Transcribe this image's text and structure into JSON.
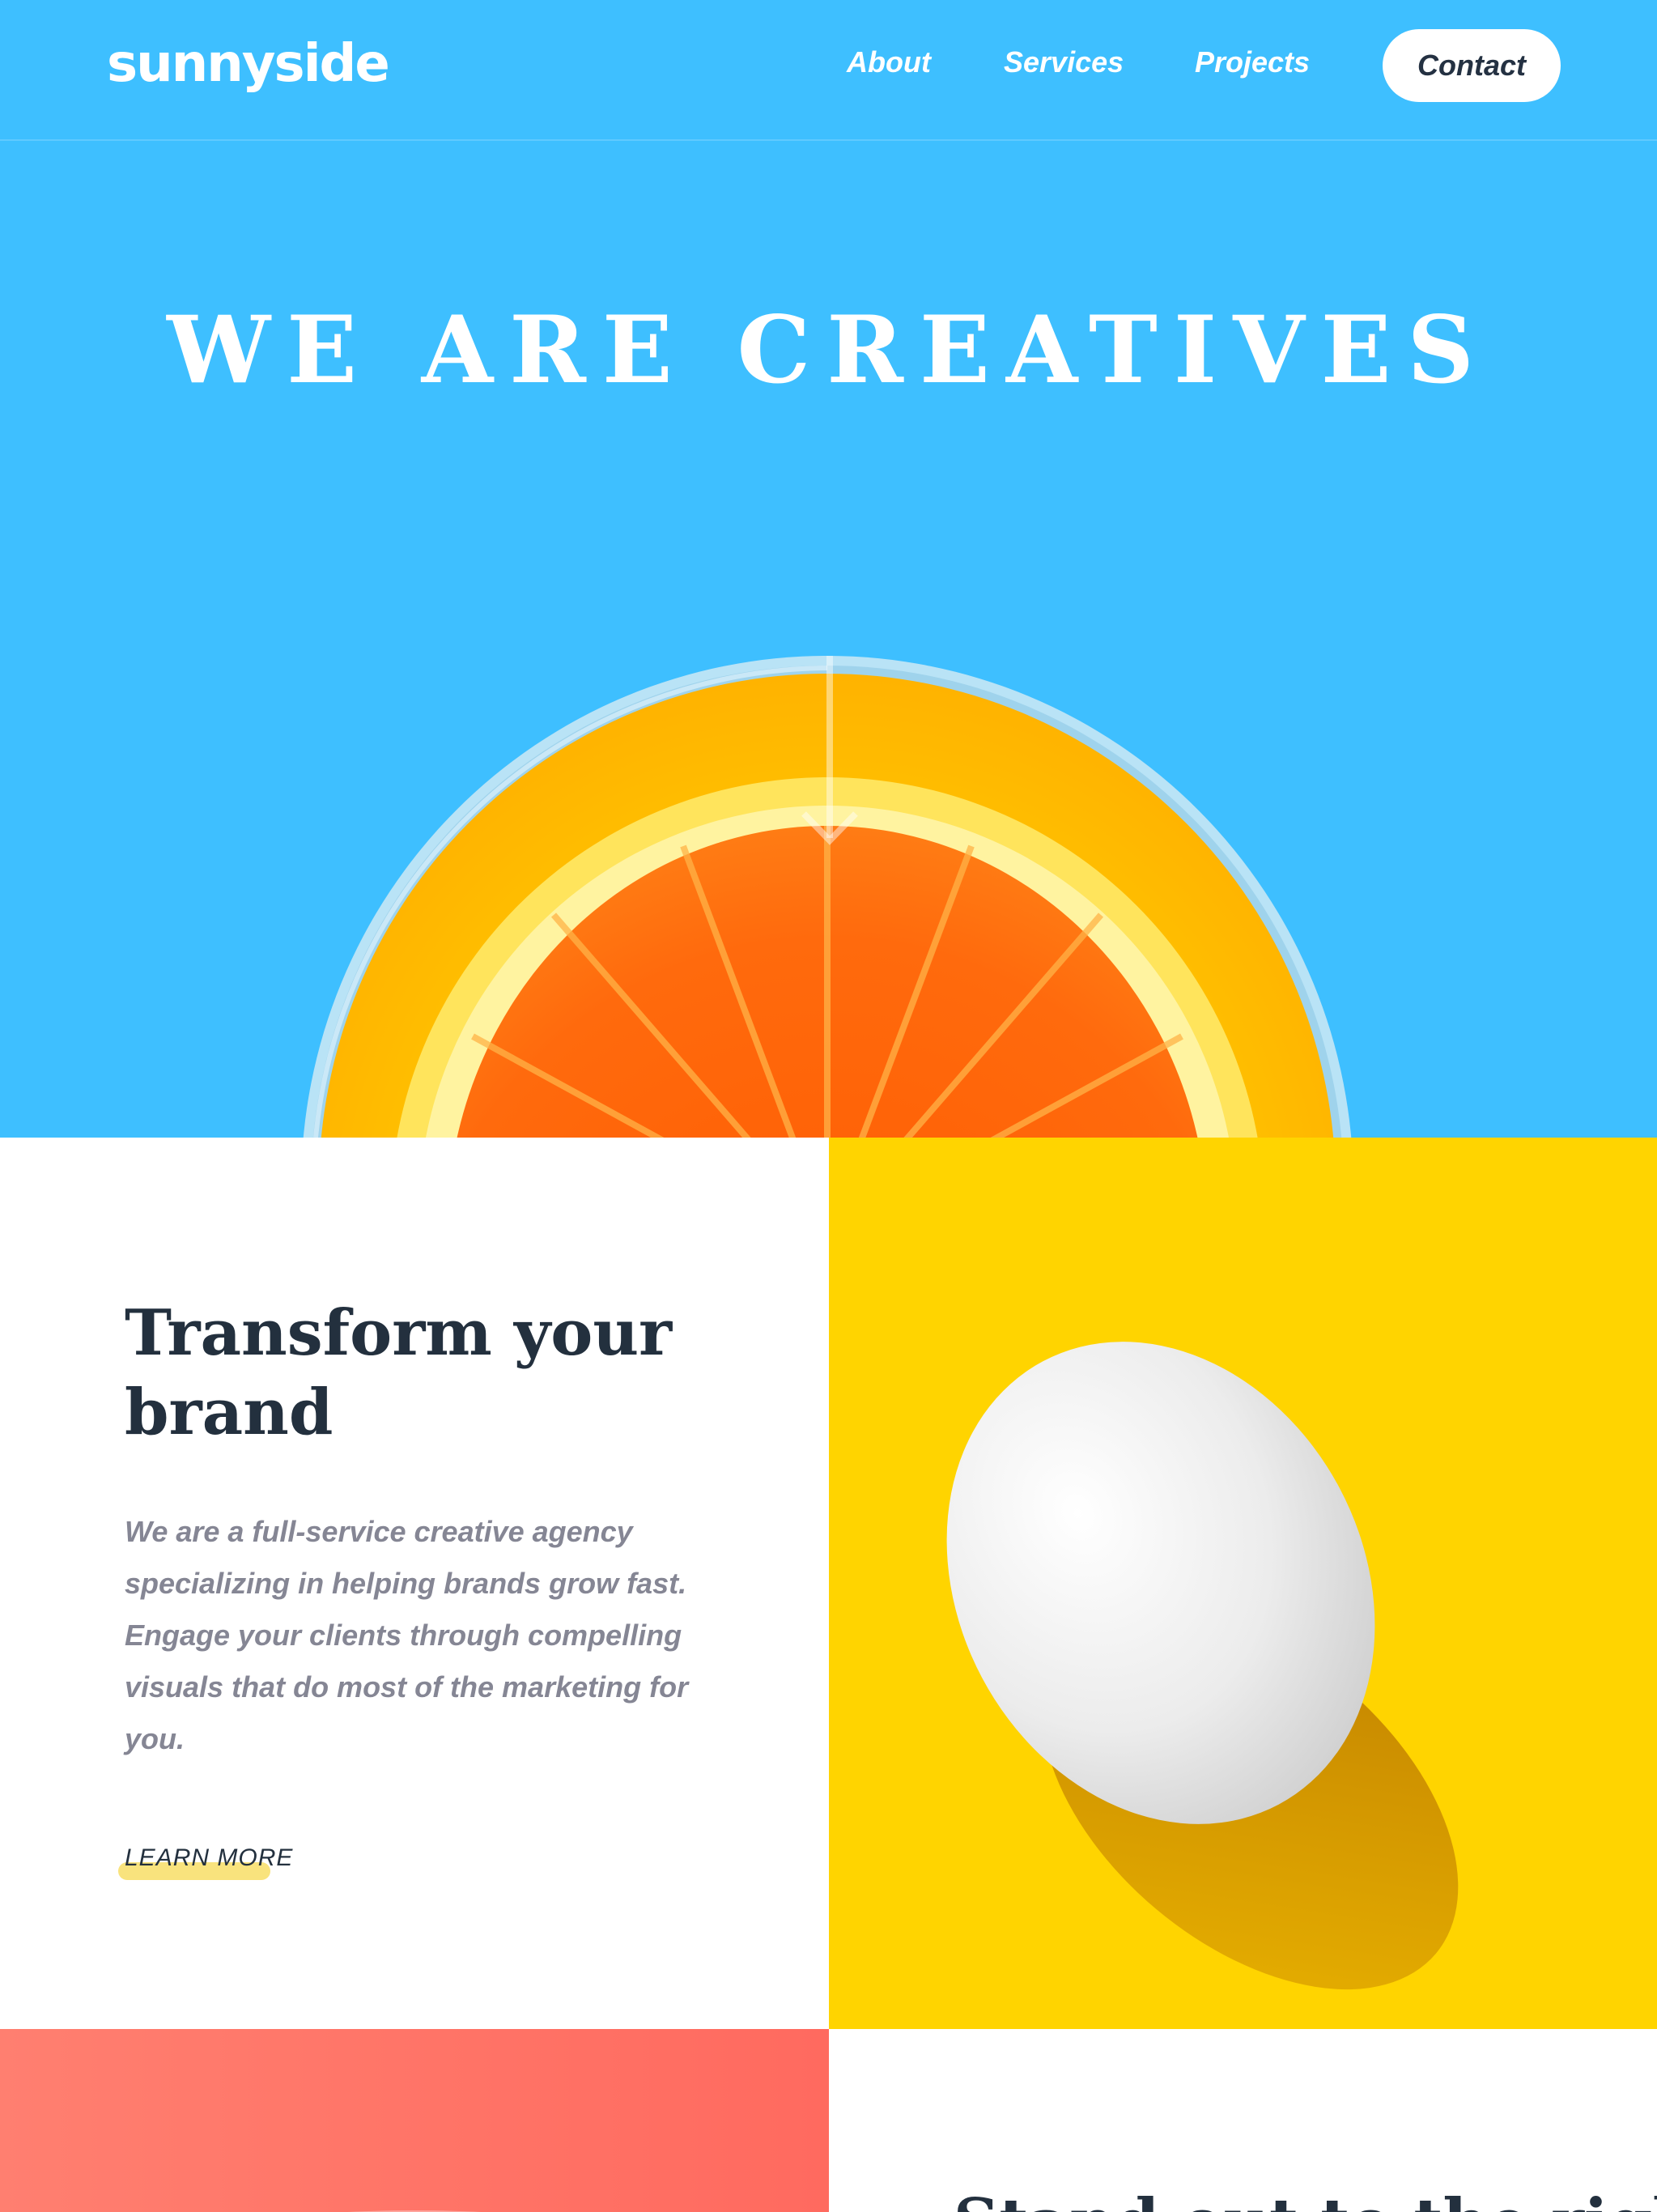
{
  "header": {
    "logo": "sunnyside",
    "nav": {
      "about": "About",
      "services": "Services",
      "projects": "Projects",
      "contact": "Contact"
    }
  },
  "hero": {
    "title": "WE ARE CREATIVES",
    "image": "orange-slice-in-glass",
    "arrow_icon": "arrow-down-icon"
  },
  "transform": {
    "title": "Transform your brand",
    "body": "We are a full-service creative agency specializing in helping brands grow fast. Engage your clients through compelling visuals that do most of the marketing for you.",
    "cta": "LEARN MORE",
    "image": "white-egg-on-yellow"
  },
  "standout": {
    "title": "Stand out to the right audience",
    "image": "glass-on-coral"
  },
  "colors": {
    "hero_blue": "#3ebfff",
    "egg_yellow": "#ffd400",
    "coral": "#ff7f70",
    "dark_text": "#23303e",
    "body_text": "#858694",
    "cta_underline": "#f9e37d"
  }
}
